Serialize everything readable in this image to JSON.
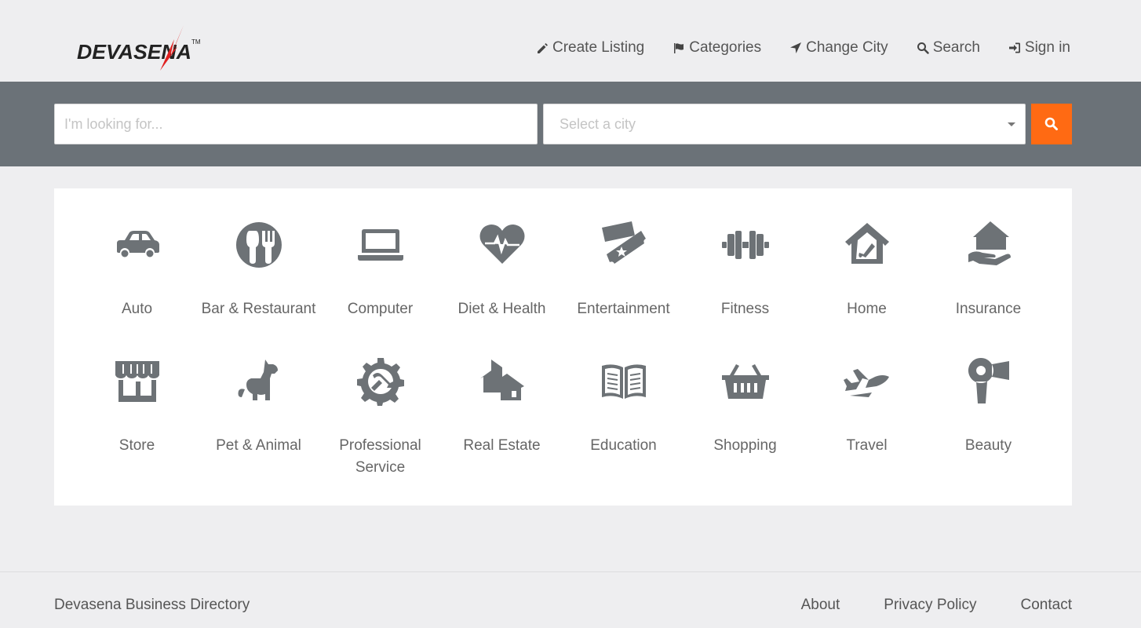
{
  "brand": {
    "name": "DEVASENA",
    "tm": "TM",
    "accent": "#e02020"
  },
  "nav": {
    "create_listing": "Create Listing",
    "categories": "Categories",
    "change_city": "Change City",
    "search": "Search",
    "sign_in": "Sign in"
  },
  "search": {
    "query_placeholder": "I'm looking for...",
    "city_placeholder": "Select a city",
    "button_color": "#ff6a13"
  },
  "categories": [
    {
      "label": "Auto",
      "icon": "car-icon"
    },
    {
      "label": "Bar & Restaurant",
      "icon": "utensils-icon"
    },
    {
      "label": "Computer",
      "icon": "laptop-icon"
    },
    {
      "label": "Diet & Health",
      "icon": "heartbeat-icon"
    },
    {
      "label": "Entertainment",
      "icon": "ticket-icon"
    },
    {
      "label": "Fitness",
      "icon": "dumbbell-icon"
    },
    {
      "label": "Home",
      "icon": "house-brush-icon"
    },
    {
      "label": "Insurance",
      "icon": "hand-house-icon"
    },
    {
      "label": "Store",
      "icon": "store-icon"
    },
    {
      "label": "Pet & Animal",
      "icon": "dog-icon"
    },
    {
      "label": "Professional Service",
      "icon": "gear-wrench-icon"
    },
    {
      "label": "Real Estate",
      "icon": "houses-icon"
    },
    {
      "label": "Education",
      "icon": "book-icon"
    },
    {
      "label": "Shopping",
      "icon": "basket-icon"
    },
    {
      "label": "Travel",
      "icon": "plane-icon"
    },
    {
      "label": "Beauty",
      "icon": "hair-dryer-icon"
    }
  ],
  "footer": {
    "title": "Devasena Business Directory",
    "about": "About",
    "privacy": "Privacy Policy",
    "contact": "Contact"
  }
}
